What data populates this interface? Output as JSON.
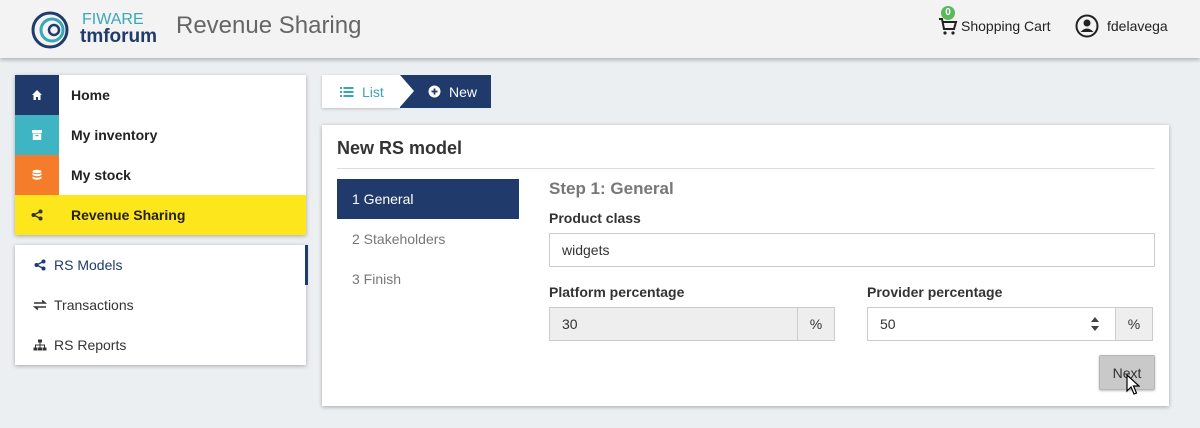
{
  "header": {
    "brand_line1": "FIWARE",
    "brand_line2": "tmforum",
    "app_title": "Revenue Sharing",
    "cart_count": "0",
    "cart_label": "Shopping Cart",
    "username": "fdelavega"
  },
  "sidebar": {
    "items": [
      {
        "label": "Home",
        "icon": "home-icon",
        "color": "#1f3a6b"
      },
      {
        "label": "My inventory",
        "icon": "archive-icon",
        "color": "#3fb5c3"
      },
      {
        "label": "My stock",
        "icon": "database-icon",
        "color": "#f47c2a"
      },
      {
        "label": "Revenue Sharing",
        "icon": "share-icon",
        "color": "#fde61b"
      }
    ],
    "sub_items": [
      {
        "label": "RS Models",
        "icon": "share-icon"
      },
      {
        "label": "Transactions",
        "icon": "exchange-icon"
      },
      {
        "label": "RS Reports",
        "icon": "sitemap-icon"
      }
    ]
  },
  "breadcrumb": {
    "list_label": "List",
    "new_label": "New"
  },
  "panel": {
    "title": "New RS model",
    "steps": [
      "1 General",
      "2 Stakeholders",
      "3 Finish"
    ],
    "step_title": "Step 1: General",
    "product_class_label": "Product class",
    "product_class_value": "widgets",
    "platform_label": "Platform percentage",
    "platform_value": "30",
    "provider_label": "Provider percentage",
    "provider_value": "50",
    "percent_symbol": "%",
    "next_label": "Next"
  },
  "colors": {
    "primary": "#1f3a6b",
    "active_bg": "#fde61b",
    "link": "#3aa7b7",
    "badge": "#5cb85c"
  }
}
